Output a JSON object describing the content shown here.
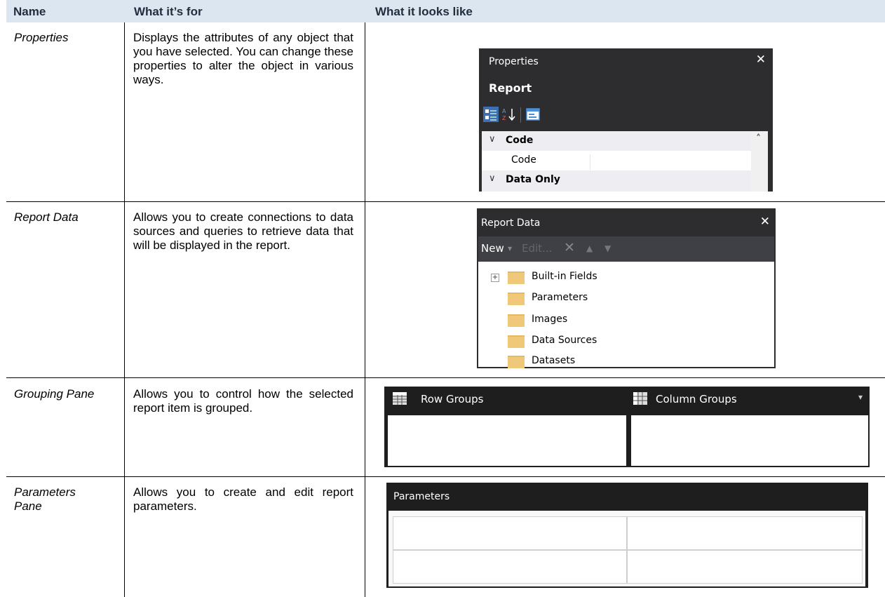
{
  "headers": {
    "name": "Name",
    "purpose": "What it’s for",
    "looks": "What it looks like"
  },
  "rows": [
    {
      "name": "Properties",
      "description": "Displays the attributes of any object that you have selected. You can change these properties to alter the object in various ways."
    },
    {
      "name": "Report Data",
      "description": "Allows you to create connections to data sources and queries to retrieve data that will be displayed in the report."
    },
    {
      "name": "Grouping Pane",
      "description": "Allows you to control how the selected report item is grouped."
    },
    {
      "name": "Parameters Pane",
      "description": "Allows you to create and edit report parameters."
    }
  ],
  "properties_pane": {
    "title": "Properties",
    "close": "✕",
    "object": "Report",
    "grid": [
      {
        "chevron": "∨",
        "label": "Code",
        "category": true
      },
      {
        "chevron": "",
        "label": "Code",
        "category": false
      },
      {
        "chevron": "∨",
        "label": "Data Only",
        "category": true
      }
    ],
    "scroll_up": "˄"
  },
  "report_data_pane": {
    "title": "Report Data",
    "close": "✕",
    "toolbar": {
      "new": "New",
      "new_arrow": "▾",
      "edit": "Edit...",
      "delete": "✕",
      "up": "▲",
      "down": "▼"
    },
    "expander": "+",
    "items": [
      "Built-in Fields",
      "Parameters",
      "Images",
      "Data Sources",
      "Datasets"
    ]
  },
  "grouping_pane": {
    "row_groups": "Row Groups",
    "column_groups": "Column Groups",
    "dropdown": "▾"
  },
  "parameters_pane": {
    "title": "Parameters"
  }
}
